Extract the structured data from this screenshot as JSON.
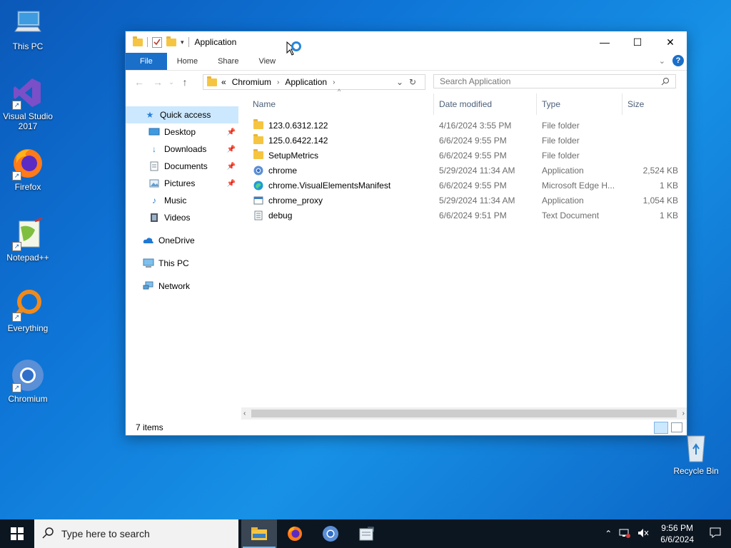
{
  "desktop": {
    "icons": [
      {
        "label": "This PC"
      },
      {
        "label": "Visual Studio 2017"
      },
      {
        "label": "Firefox"
      },
      {
        "label": "Notepad++"
      },
      {
        "label": "Everything"
      },
      {
        "label": "Chromium"
      },
      {
        "label": "Recycle Bin"
      }
    ]
  },
  "window": {
    "title": "Application",
    "ribbon_tabs": [
      "File",
      "Home",
      "Share",
      "View"
    ],
    "help_label": "?",
    "address": {
      "overflow": "«",
      "segments": [
        "Chromium",
        "Application"
      ]
    },
    "search_placeholder": "Search Application",
    "nav": [
      {
        "label": "Quick access",
        "icon": "star-icon",
        "selected": true
      },
      {
        "label": "Desktop",
        "icon": "desktop-icon",
        "pinned": true
      },
      {
        "label": "Downloads",
        "icon": "download-icon",
        "pinned": true
      },
      {
        "label": "Documents",
        "icon": "document-icon",
        "pinned": true
      },
      {
        "label": "Pictures",
        "icon": "pictures-icon",
        "pinned": true
      },
      {
        "label": "Music",
        "icon": "music-icon"
      },
      {
        "label": "Videos",
        "icon": "video-icon"
      },
      {
        "label": "OneDrive",
        "icon": "cloud-icon"
      },
      {
        "label": "This PC",
        "icon": "computer-icon"
      },
      {
        "label": "Network",
        "icon": "network-icon"
      }
    ],
    "columns": [
      "Name",
      "Date modified",
      "Type",
      "Size"
    ],
    "files": [
      {
        "name": "123.0.6312.122",
        "date": "4/16/2024 3:55 PM",
        "type": "File folder",
        "size": "",
        "icon": "folder-icon"
      },
      {
        "name": "125.0.6422.142",
        "date": "6/6/2024 9:55 PM",
        "type": "File folder",
        "size": "",
        "icon": "folder-icon"
      },
      {
        "name": "SetupMetrics",
        "date": "6/6/2024 9:55 PM",
        "type": "File folder",
        "size": "",
        "icon": "folder-icon"
      },
      {
        "name": "chrome",
        "date": "5/29/2024 11:34 AM",
        "type": "Application",
        "size": "2,524 KB",
        "icon": "chromium-icon"
      },
      {
        "name": "chrome.VisualElementsManifest",
        "date": "6/6/2024 9:55 PM",
        "type": "Microsoft Edge H...",
        "size": "1 KB",
        "icon": "edge-icon"
      },
      {
        "name": "chrome_proxy",
        "date": "5/29/2024 11:34 AM",
        "type": "Application",
        "size": "1,054 KB",
        "icon": "app-icon"
      },
      {
        "name": "debug",
        "date": "6/6/2024 9:51 PM",
        "type": "Text Document",
        "size": "1 KB",
        "icon": "text-file-icon"
      }
    ],
    "status": "7 items"
  },
  "taskbar": {
    "search_placeholder": "Type here to search",
    "time": "9:56 PM",
    "date": "6/6/2024"
  }
}
